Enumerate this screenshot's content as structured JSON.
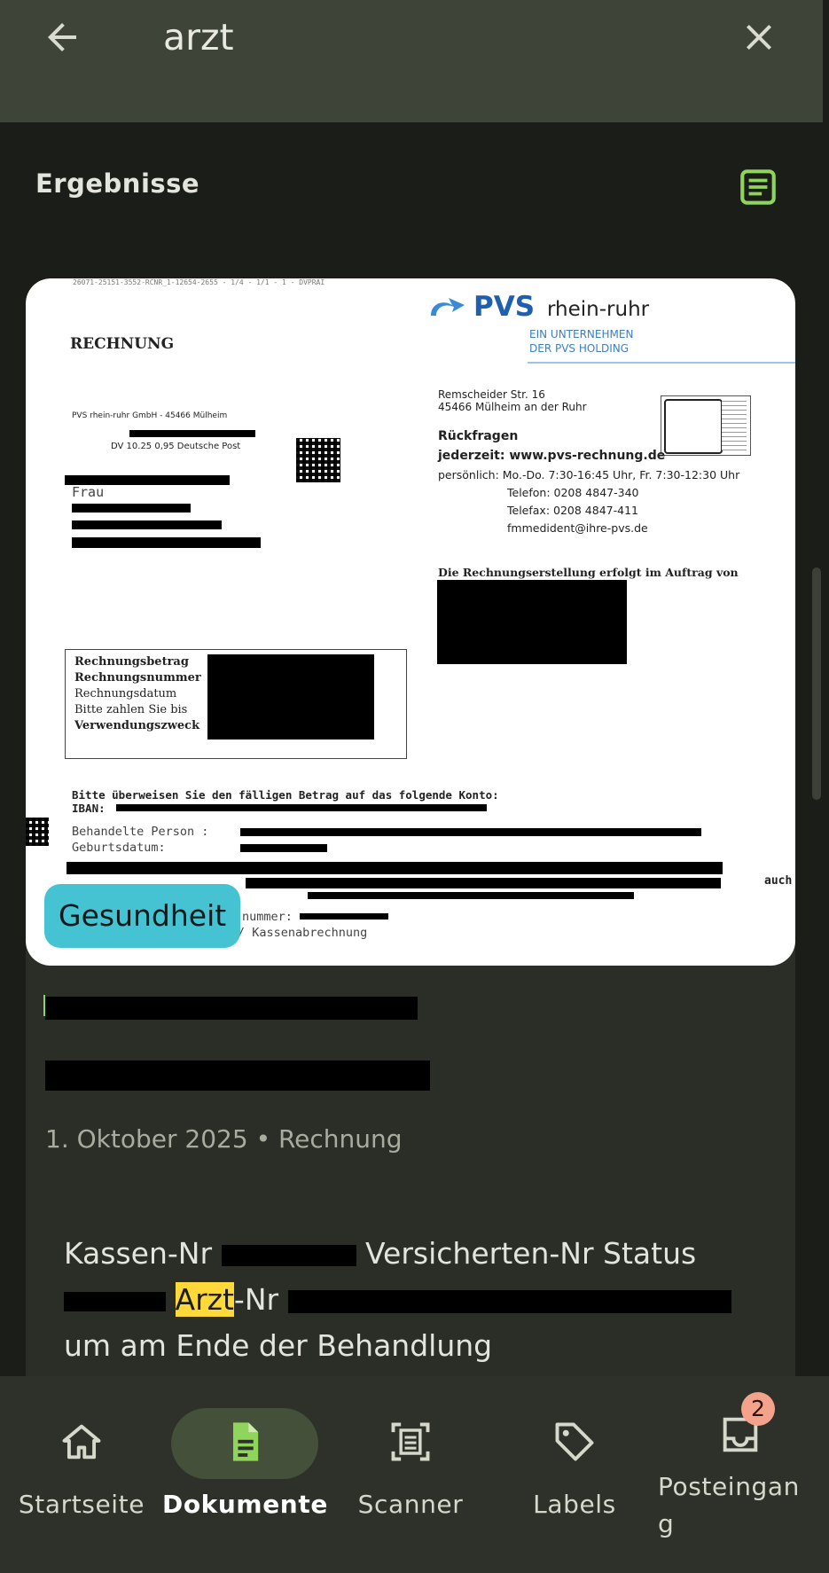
{
  "search": {
    "query": "arzt"
  },
  "results": {
    "title": "Ergebnisse"
  },
  "document": {
    "thumbnail": {
      "header_code": "26071-25151-3552-RCNR_1-12654-2655 - 1/4 - 1/1 - 1 - DVPRAI",
      "rechnung": "RECHNUNG",
      "sender_line": "PVS rhein-ruhr GmbH - 45466 Mülheim",
      "postage": "DV 10.25    0,95   Deutsche Post",
      "frau": "Frau",
      "logo_pvs": "PVS",
      "logo_region": "rhein-ruhr",
      "logo_sub1": "EIN UNTERNEHMEN",
      "logo_sub2": "DER PVS HOLDING",
      "address1": "Remscheider Str. 16",
      "address2": "45466 Mülheim an der Ruhr",
      "rueckfragen": "Rückfragen",
      "jederzeit": "jederzeit:  www.pvs-rechnung.de",
      "persoenlich": "persönlich: Mo.-Do. 7:30-16:45 Uhr, Fr. 7:30-12:30 Uhr",
      "telefon": "Telefon: 0208 4847-340",
      "telefax": "Telefax: 0208 4847-411",
      "email": "fmmedident@ihre-pvs.de",
      "auftrag": "Die Rechnungserstellung erfolgt im Auftrag von",
      "box_labels": [
        "Rechnungsbetrag",
        "Rechnungsnummer",
        "Rechnungsdatum",
        "Bitte zahlen Sie bis",
        "Verwendungszweck"
      ],
      "ueberweisen": "Bitte überweisen Sie den fälligen Betrag auf das folgende Konto:",
      "iban": "IBAN:",
      "behandelte": "Behandelte Person :",
      "geburtsdatum": "Geburtsdatum:",
      "auch_di": "auch di",
      "nummer": "nummer:",
      "spezifiziert": "Spezifiziert nach BEMA / Kassenabrechnung"
    },
    "label": "Gesundheit",
    "date": "1. Oktober 2025",
    "separator": "•",
    "type": "Rechnung",
    "snippet": {
      "p1": "Kassen-Nr",
      "p2": "Versicherten-Nr Status",
      "highlight": "Arzt",
      "p3": "-Nr",
      "line3": "um am Ende der Behandlung"
    }
  },
  "nav": {
    "items": [
      {
        "label": "Startseite",
        "icon": "home-icon"
      },
      {
        "label": "Dokumente",
        "icon": "document-icon"
      },
      {
        "label": "Scanner",
        "icon": "scanner-icon"
      },
      {
        "label": "Labels",
        "icon": "label-icon"
      },
      {
        "label": "Posteingan\ng",
        "icon": "inbox-icon"
      }
    ],
    "inbox_badge": "2"
  },
  "colors": {
    "topbar": "#3f4439",
    "background": "#1b1d19",
    "card": "#2b2e27",
    "accent_green": "#8fd45b",
    "label_chip": "#45c3d3",
    "highlight": "#ffd93a",
    "badge": "#f4a28c"
  }
}
